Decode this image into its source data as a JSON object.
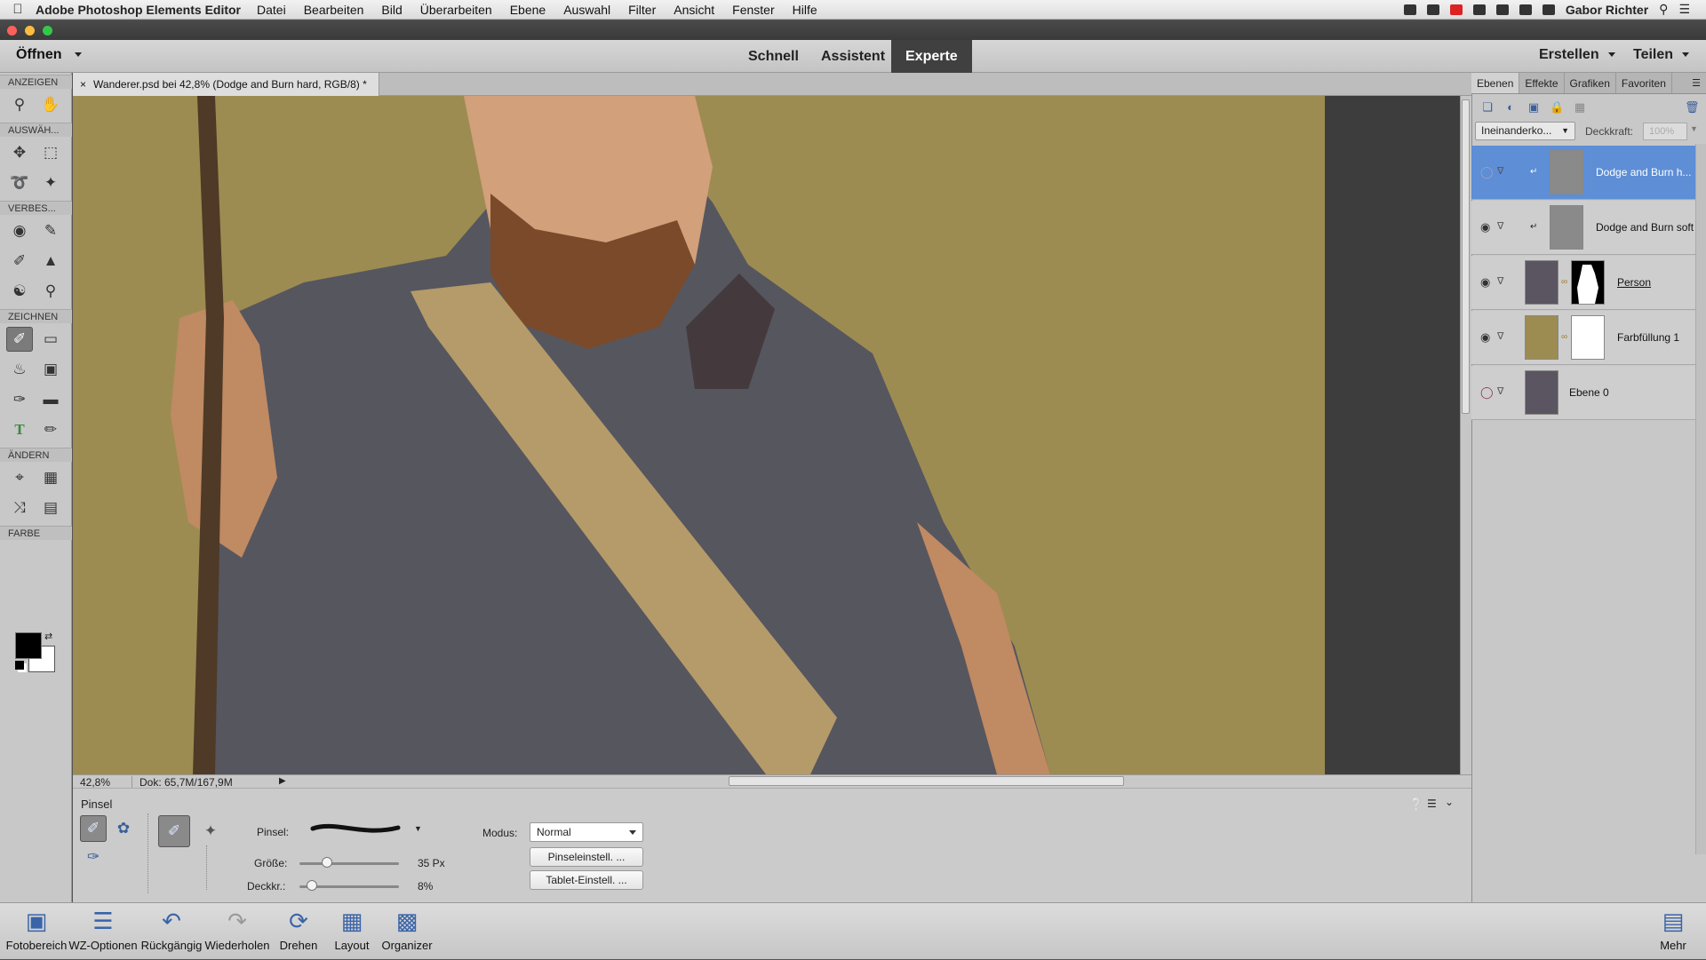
{
  "menubar": {
    "app_name": "Adobe Photoshop Elements Editor",
    "items": [
      "Datei",
      "Bearbeiten",
      "Bild",
      "Überarbeiten",
      "Ebene",
      "Auswahl",
      "Filter",
      "Ansicht",
      "Fenster",
      "Hilfe"
    ],
    "user": "Gabor Richter"
  },
  "appbar": {
    "open_label": "Öffnen",
    "modes": [
      "Schnell",
      "Assistent",
      "Experte"
    ],
    "active_mode": "Experte",
    "create_label": "Erstellen",
    "share_label": "Teilen"
  },
  "toolbox": {
    "sections": [
      "ANZEIGEN",
      "AUSWÄH...",
      "VERBES...",
      "ZEICHNEN",
      "ÄNDERN",
      "FARBE"
    ]
  },
  "document": {
    "tab_title": "Wanderer.psd bei 42,8% (Dodge and Burn hard, RGB/8) *",
    "zoom": "42,8%",
    "doc_info": "Dok: 65,7M/167,9M"
  },
  "tool_options": {
    "tool_name": "Pinsel",
    "brush_label": "Pinsel:",
    "size_label": "Größe:",
    "size_value": "35 Px",
    "size_fraction": 0.25,
    "opacity_label": "Deckkr.:",
    "opacity_value": "8%",
    "opacity_fraction": 0.08,
    "mode_label": "Modus:",
    "mode_value": "Normal",
    "brush_settings_btn": "Pinseleinstell. ...",
    "tablet_settings_btn": "Tablet-Einstell. ..."
  },
  "layers_panel": {
    "tabs": [
      "Ebenen",
      "Effekte",
      "Grafiken",
      "Favoriten"
    ],
    "active_tab": "Ebenen",
    "blend_mode": "Ineinanderko...",
    "opacity_label": "Deckkraft:",
    "opacity_value": "100%",
    "layers": [
      {
        "name": "Dodge and Burn h...",
        "selected": true,
        "visible": false,
        "thumb": "#8a8a8a"
      },
      {
        "name": "Dodge and Burn soft",
        "selected": false,
        "visible": true,
        "thumb": "#8a8a8a"
      },
      {
        "name": "Person",
        "selected": false,
        "visible": true,
        "thumb": "#5a5560",
        "mask": true
      },
      {
        "name": "Farbfüllung 1",
        "selected": false,
        "visible": true,
        "thumb": "#9d8c52",
        "mask": true
      },
      {
        "name": "Ebene 0",
        "selected": false,
        "visible": false,
        "thumb": "#5a5560"
      }
    ]
  },
  "bottombar": {
    "items": [
      "Fotobereich",
      "WZ-Optionen",
      "Rückgängig",
      "Wiederholen",
      "Drehen",
      "Layout",
      "Organizer"
    ],
    "more_label": "Mehr"
  },
  "colors": {
    "canvas_bg": "#9d8c52",
    "selected_layer": "#5d8ed6"
  }
}
